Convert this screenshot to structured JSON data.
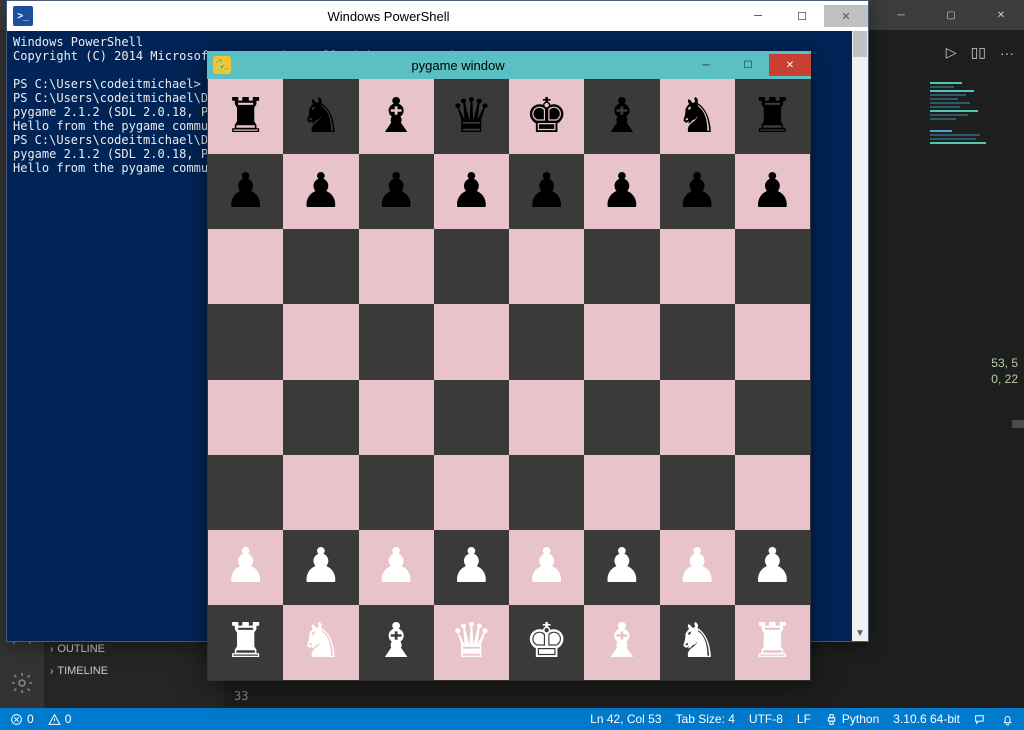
{
  "vscode": {
    "toprun": {
      "play": "▷",
      "split": "▯▯",
      "more": "···"
    },
    "text_fragment1": "53, 5",
    "text_fragment2": "0, 22",
    "side": {
      "outline": "OUTLINE",
      "timeline": "TIMELINE"
    },
    "gutter_line": "33"
  },
  "status": {
    "errors": "0",
    "warnings": "0",
    "ln_col": "Ln 42, Col 53",
    "tab": "Tab Size: 4",
    "enc": "UTF-8",
    "eol": "LF",
    "lang": "Python",
    "interp": "3.10.6 64-bit"
  },
  "powershell": {
    "title": "Windows PowerShell",
    "lines": [
      "Windows PowerShell",
      "Copyright (C) 2014 Microsoft Corporation. All rights reserved.",
      "",
      "PS C:\\Users\\codeitmichael> c",
      "PS C:\\Users\\codeitmichael\\Do",
      "pygame 2.1.2 (SDL 2.0.18, Py",
      "Hello from the pygame commun",
      "PS C:\\Users\\codeitmichael\\Do",
      "pygame 2.1.2 (SDL 2.0.18, Py",
      "Hello from the pygame commun"
    ]
  },
  "pygame": {
    "title": "pygame window",
    "board_colors": {
      "light": "#e8c3ca",
      "dark": "#3a3a3a"
    },
    "pieces": {
      "black_back": [
        "R",
        "N",
        "B",
        "Q",
        "K",
        "B",
        "N",
        "R"
      ],
      "black_pawn": "P",
      "white_pawn": "P",
      "white_back": [
        "R",
        "N",
        "B",
        "Q",
        "K",
        "B",
        "N",
        "R"
      ]
    },
    "glyphs": {
      "R": "♜",
      "N": "♞",
      "B": "♝",
      "Q": "♛",
      "K": "♚",
      "P": "♟"
    }
  }
}
